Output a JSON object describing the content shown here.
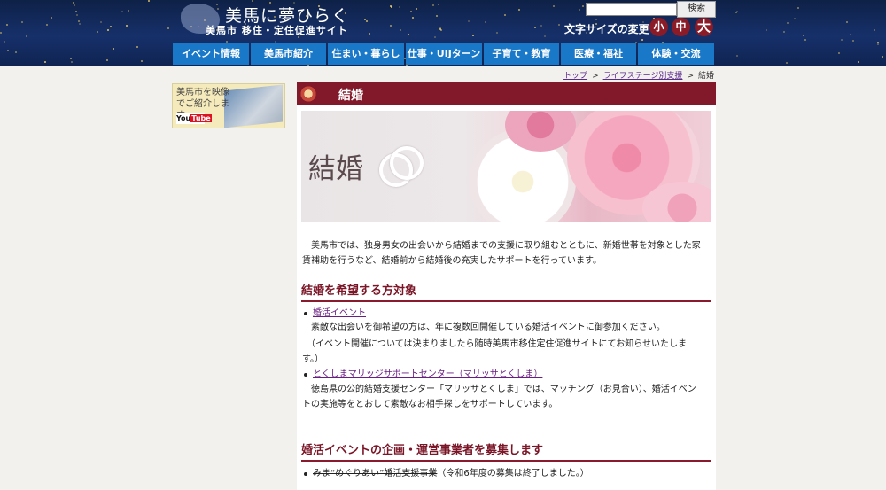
{
  "header": {
    "logo_title": "美馬に夢ひらく",
    "logo_sub": "美馬市 移住・定住促進サイト",
    "search_placeholder": "",
    "search_button": "検索",
    "font_size_label": "文字サイズの変更",
    "font_sizes": [
      "小",
      "中",
      "大"
    ],
    "nav": [
      "イベント情報",
      "美馬市紹介",
      "住まい・暮らし",
      "仕事・UIJターン",
      "子育て・教育",
      "医療・福祉",
      "体験・交流"
    ]
  },
  "breadcrumb": [
    "トップ",
    "ライフステージ別支援",
    "結婚"
  ],
  "sidebar": {
    "banner_text": "美馬市を映像でご紹介します",
    "banner_logo_you": "You",
    "banner_logo_tube": "Tube"
  },
  "main": {
    "page_title": "結婚",
    "hero_text": "結婚",
    "intro": "　美馬市では、独身男女の出会いから結婚までの支援に取り組むとともに、新婚世帯を対象とした家賃補助を行うなど、結婚前から結婚後の充実したサポートを行っています。",
    "section1_title": "結婚を希望する方対象",
    "item1_link": "婚活イベント",
    "item1_text1": "　素敵な出会いを御希望の方は、年に複数回開催している婚活イベントに御参加ください。",
    "item1_text2": "　（イベント開催については決まりましたら随時美馬市移住定住促進サイトにてお知らせいたします。）",
    "item2_link": "とくしまマリッジサポートセンター（マリッサとくしま）",
    "item2_text": "　徳島県の公的結婚支援センター「マリッサとくしま」では、マッチング（お見合い）、婚活イベントの実施等をとおして素敵なお相手探しをサポートしています。",
    "section2_title": "婚活イベントの企画・運営事業者を募集します",
    "item3_strike": "みま“めぐりあい”婚活支援事業",
    "item3_note": "（令和6年度の募集は終了しました。）"
  }
}
